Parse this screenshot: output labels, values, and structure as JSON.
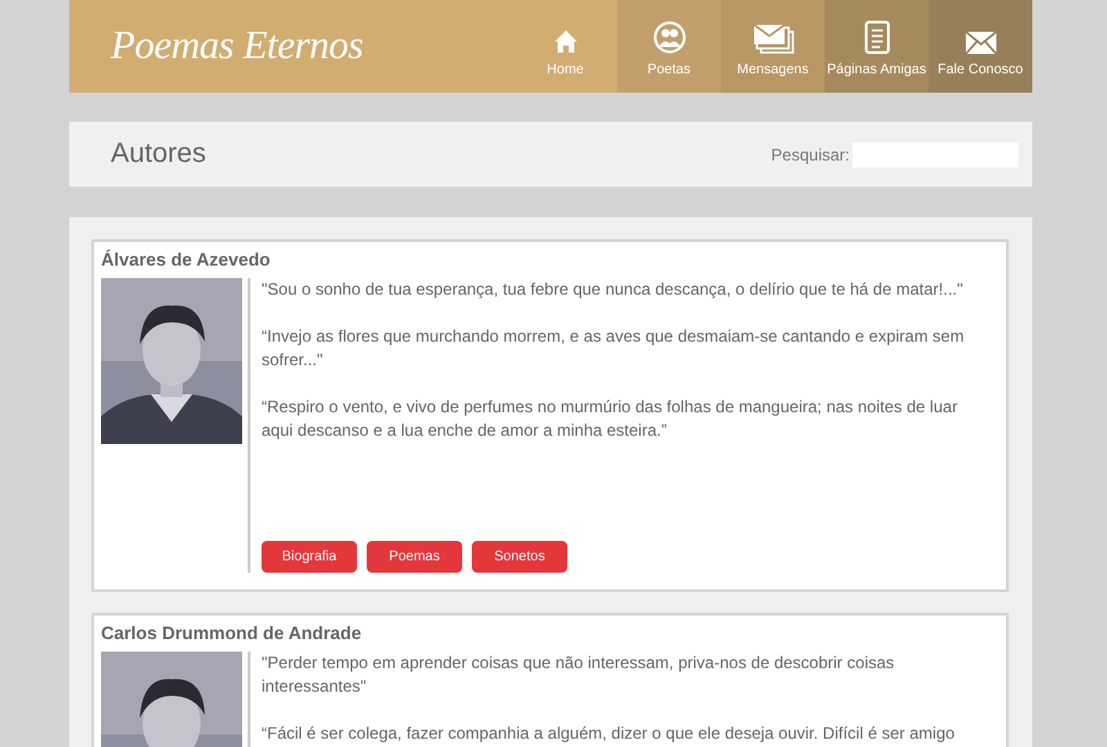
{
  "header": {
    "logo": "Poemas Eternos",
    "nav": [
      {
        "label": "Home",
        "kind": "home",
        "color": "#d2ad72"
      },
      {
        "label": "Poetas",
        "kind": "people",
        "color": "#c3a06b"
      },
      {
        "label": "Mensagens",
        "kind": "stack",
        "color": "#b89765"
      },
      {
        "label": "Páginas Amigas",
        "kind": "page",
        "color": "#a68a5e"
      },
      {
        "label": "Fale Conosco",
        "kind": "mail",
        "color": "#978059"
      }
    ]
  },
  "title_bar": {
    "title": "Autores",
    "search_label": "Pesquisar:"
  },
  "authors": [
    {
      "name": "Álvares de Azevedo",
      "photo": {
        "kind": "picture"
      },
      "quotes": [
        "\"Sou o sonho de tua esperança, tua febre que nunca descança, o delírio que te há de matar!...\"",
        "“Invejo as flores que murchando morrem, e as aves que desmaiam-se cantando e expiram sem sofrer...\"",
        "“Respiro o vento, e vivo de perfumes no murmúrio das folhas de mangueira; nas noites de luar aqui descanso e a lua enche de amor a minha esteira.”"
      ],
      "buttons": [
        "Biografia",
        "Poemas",
        "Sonetos"
      ]
    },
    {
      "name": "Carlos Drummond de Andrade",
      "photo": {
        "kind": "picture"
      },
      "quotes": [
        "\"Perder tempo em aprender coisas que não interessam, priva-nos de descobrir coisas interessantes\"",
        "“Fácil é ser colega, fazer companhia a alguém, dizer o que ele deseja ouvir. Difícil é ser amigo"
      ]
    }
  ]
}
